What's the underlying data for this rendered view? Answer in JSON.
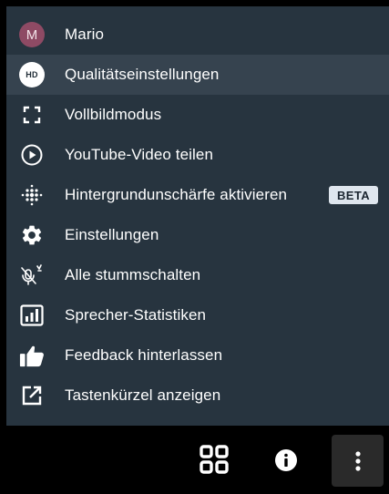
{
  "menu": {
    "items": [
      {
        "id": "user",
        "label": "Mario",
        "icon": "user-avatar",
        "avatar_letter": "M"
      },
      {
        "id": "quality",
        "label": "Qualitätseinstellungen",
        "icon": "hd-icon",
        "badge_text": "HD",
        "active": true
      },
      {
        "id": "fullscreen",
        "label": "Vollbildmodus",
        "icon": "fullscreen-icon"
      },
      {
        "id": "share-video",
        "label": "YouTube-Video teilen",
        "icon": "play-circle-icon"
      },
      {
        "id": "blur",
        "label": "Hintergrundunschärfe aktivieren",
        "icon": "blur-dots-icon",
        "tag": "BETA"
      },
      {
        "id": "settings",
        "label": "Einstellungen",
        "icon": "gear-icon"
      },
      {
        "id": "mute-all",
        "label": "Alle stummschalten",
        "icon": "mic-muted-icon"
      },
      {
        "id": "stats",
        "label": "Sprecher-Statistiken",
        "icon": "bar-chart-icon"
      },
      {
        "id": "feedback",
        "label": "Feedback hinterlassen",
        "icon": "thumbs-up-icon"
      },
      {
        "id": "shortcuts",
        "label": "Tastenkürzel anzeigen",
        "icon": "external-link-icon"
      }
    ]
  },
  "toolbar": {
    "buttons": [
      "grid-view-icon",
      "info-icon",
      "more-vertical-icon"
    ]
  },
  "colors": {
    "menu_bg": "#27343f",
    "active_item_bg": "#36434f",
    "avatar_bg": "#8e4a64",
    "beta_bg": "#dfe6ee",
    "page_bg": "#000000"
  }
}
